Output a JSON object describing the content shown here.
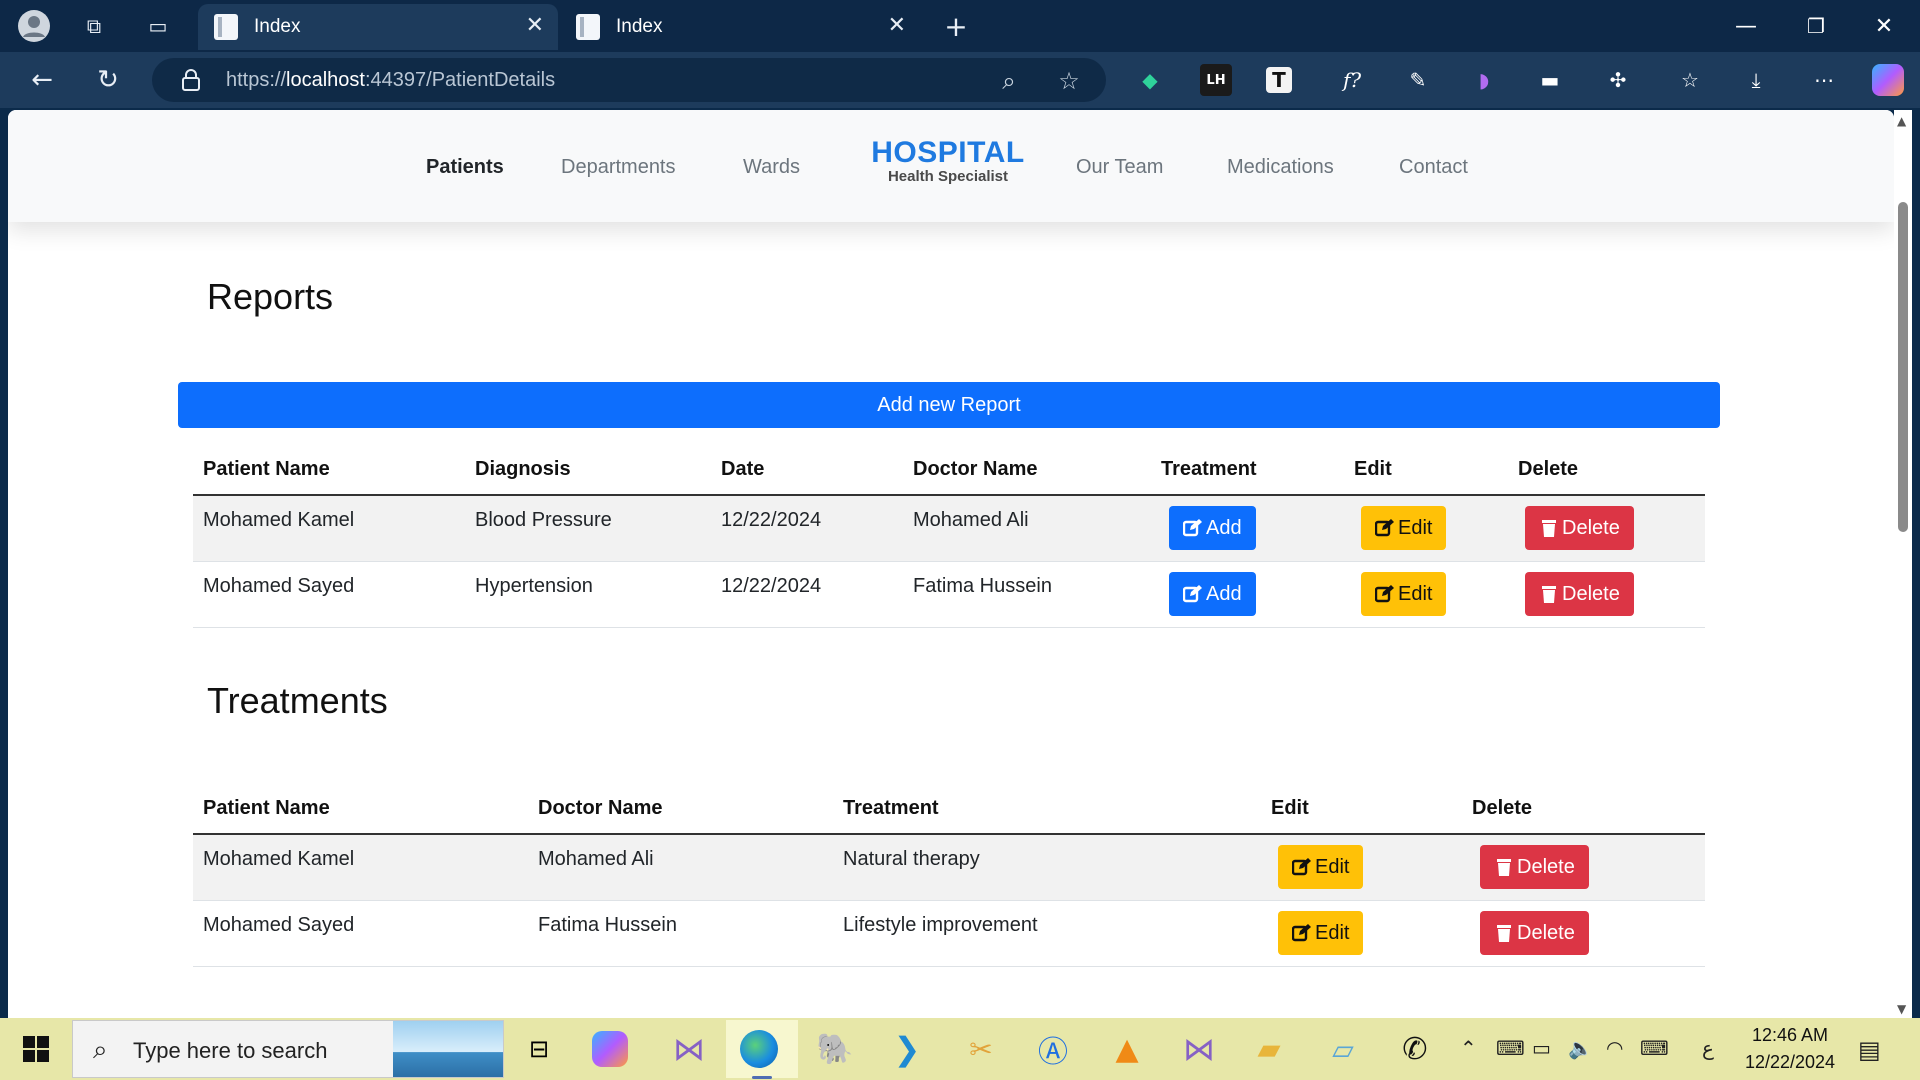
{
  "browser": {
    "tabs": [
      {
        "title": "Index",
        "active": true
      },
      {
        "title": "Index",
        "active": false
      }
    ],
    "url_prefix": "https://",
    "url_host": "localhost",
    "url_rest": ":44397/PatientDetails"
  },
  "site": {
    "nav": [
      "Patients",
      "Departments",
      "Wards",
      "Our Team",
      "Medications",
      "Contact"
    ],
    "active_nav": "Patients",
    "brand_title": "HOSPITAL",
    "brand_subtitle": "Health Specialist"
  },
  "reports": {
    "title": "Reports",
    "add_button": "Add new Report",
    "columns": [
      "Patient Name",
      "Diagnosis",
      "Date",
      "Doctor Name",
      "Treatment",
      "Edit",
      "Delete"
    ],
    "rows": [
      {
        "patient": "Mohamed Kamel",
        "diagnosis": "Blood Pressure",
        "date": "12/22/2024",
        "doctor": "Mohamed Ali",
        "treatment_btn": "Add",
        "edit_btn": "Edit",
        "delete_btn": "Delete"
      },
      {
        "patient": "Mohamed Sayed",
        "diagnosis": "Hypertension",
        "date": "12/22/2024",
        "doctor": "Fatima Hussein",
        "treatment_btn": "Add",
        "edit_btn": "Edit",
        "delete_btn": "Delete"
      }
    ]
  },
  "treatments": {
    "title": "Treatments",
    "columns": [
      "Patient Name",
      "Doctor Name",
      "Treatment",
      "Edit",
      "Delete"
    ],
    "rows": [
      {
        "patient": "Mohamed Kamel",
        "doctor": "Mohamed Ali",
        "treatment": "Natural therapy",
        "edit_btn": "Edit",
        "delete_btn": "Delete"
      },
      {
        "patient": "Mohamed Sayed",
        "doctor": "Fatima Hussein",
        "treatment": "Lifestyle improvement",
        "edit_btn": "Edit",
        "delete_btn": "Delete"
      }
    ]
  },
  "taskbar": {
    "search_placeholder": "Type here to search",
    "time": "12:46 AM",
    "date": "12/22/2024",
    "lang": "ع"
  },
  "colors": {
    "primary": "#0d6efd",
    "warning": "#ffc107",
    "danger": "#dc3545",
    "brand": "#1f7ae0",
    "browser_frame": "#0d2847",
    "taskbar": "#e7e7a8"
  }
}
